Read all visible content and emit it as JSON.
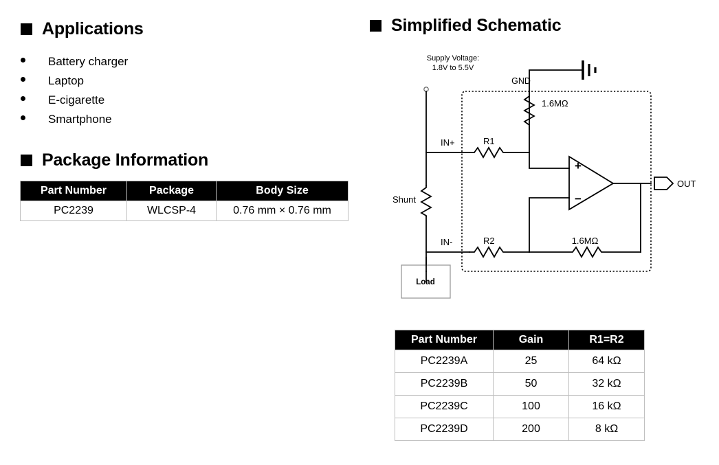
{
  "applications": {
    "heading": "Applications",
    "bullet_icon": "square-bullet",
    "items": [
      {
        "label": "Battery charger"
      },
      {
        "label": "Laptop"
      },
      {
        "label": "E-cigarette"
      },
      {
        "label": "Smartphone"
      }
    ]
  },
  "package_information": {
    "heading": "Package Information",
    "bullet_icon": "square-bullet",
    "table": {
      "columns": [
        "Part Number",
        "Package",
        "Body Size"
      ],
      "rows": [
        [
          "PC2239",
          "WLCSP-4",
          "0.76 mm × 0.76 mm"
        ]
      ]
    }
  },
  "simplified_schematic": {
    "heading": "Simplified Schematic",
    "bullet_icon": "square-bullet",
    "labels": {
      "supply_line1": "Supply Voltage:",
      "supply_line2": "1.8V to 5.5V",
      "gnd": "GND",
      "r_top": "1.6MΩ",
      "r_feedback": "1.6MΩ",
      "in_plus": "IN+",
      "in_minus": "IN-",
      "r1": "R1",
      "r2": "R2",
      "shunt": "Shunt",
      "load": "Load",
      "out": "OUT",
      "opamp_plus": "+",
      "opamp_minus": "−"
    },
    "gain_table": {
      "columns": [
        "Part Number",
        "Gain",
        "R1=R2"
      ],
      "rows": [
        [
          "PC2239A",
          "25",
          "64 kΩ"
        ],
        [
          "PC2239B",
          "50",
          "32 kΩ"
        ],
        [
          "PC2239C",
          "100",
          "16 kΩ"
        ],
        [
          "PC2239D",
          "200",
          "8 kΩ"
        ]
      ]
    }
  },
  "colors": {
    "header_background": "#000000",
    "header_text": "#ffffff",
    "table_border": "#bfbfbf",
    "body_text": "#000000",
    "page_background": "#ffffff",
    "schematic_line": "#000000",
    "load_box_border": "#9a9a9a"
  }
}
